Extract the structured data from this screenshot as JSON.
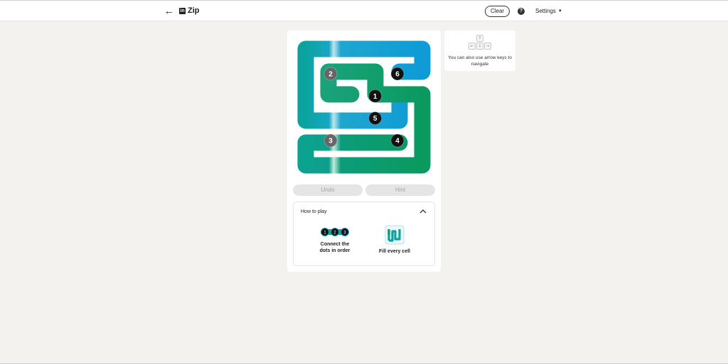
{
  "header": {
    "back_icon": "arrow-left-icon",
    "logo_text": "in",
    "title": "Zip",
    "clear_label": "Clear",
    "help_label": "?",
    "settings_label": "Settings"
  },
  "game": {
    "grid_size": 6,
    "dots": [
      {
        "number": "1",
        "row": 2,
        "col": 3
      },
      {
        "number": "2",
        "row": 1,
        "col": 1
      },
      {
        "number": "3",
        "row": 4,
        "col": 1
      },
      {
        "number": "4",
        "row": 4,
        "col": 4
      },
      {
        "number": "5",
        "row": 3,
        "col": 3
      },
      {
        "number": "6",
        "row": 1,
        "col": 4
      }
    ],
    "colors": {
      "teal": "#0aa3a0",
      "green": "#0a9a5f",
      "blue": "#0e9bd6",
      "dot": "#111111",
      "dot_muted": "#666666"
    }
  },
  "controls": {
    "undo_label": "Undo",
    "hint_label": "Hint"
  },
  "how_to_play": {
    "title": "How to play",
    "rule1_label": "Connect the dots in order",
    "rule1_dots": [
      "1",
      "2",
      "3"
    ],
    "rule2_label": "Fill every cell"
  },
  "tip": {
    "keys": {
      "up": "↑",
      "left": "←",
      "down": "↓",
      "right": "→"
    },
    "text": "You can also use arrow keys to navigate"
  }
}
